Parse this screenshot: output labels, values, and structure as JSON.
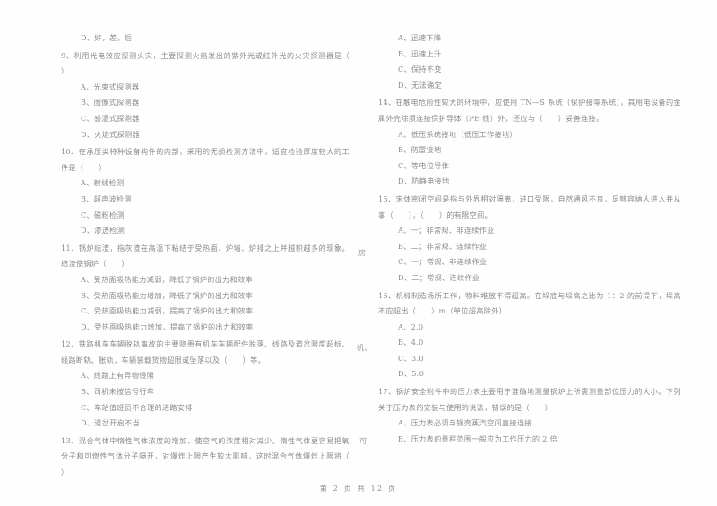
{
  "document": {
    "page_footer": "第 2 页  共 12 页",
    "page_number": "2",
    "total_pages": "12",
    "text_color": "#8a8a8a",
    "background_color": "#fefefe"
  },
  "left_column": {
    "orphan_option": "D、好，差，后",
    "questions": [
      {
        "stem": "9、利用光电效应探测火灾，主要探测火焰发出的紫外光或红外光的火灾探测器是（　　）",
        "options": [
          "A、光束式探测器",
          "B、图像式探测器",
          "C、感温式探测器",
          "D、火焰式探测器"
        ]
      },
      {
        "stem": "10、在承压类特种设备构件的内部，采用的无损检测方法中，适宜检验厚度较大的工件是（　　）",
        "options": [
          "A、射线检测",
          "B、超声波检测",
          "C、磁粉检测",
          "D、渗透检测"
        ]
      },
      {
        "stem": "11、锅炉结渣，指灰渣在高温下粘结于受热面、炉墙、炉排之上并越积越多的现象。结渣使锅炉（　　）",
        "options": [
          "A、受热面吸热能力减弱，降低了锅炉的出力和效率",
          "B、受热面吸热能力增加，降低了锅炉的出力和效率",
          "C、受热面吸热能力减弱，提高了锅炉的出力和效率",
          "D、受热面吸热能力增加，提高了锅炉的出力和效率"
        ]
      },
      {
        "stem": "12、铁路机车车辆脱轨事故的主要隐患有机车车辆配件脱落、线路及道岔限度超标、线路断轨、胀轨，车辆装载货物超限或坠落以及（　　）等。",
        "options": [
          "A、线路上有异物侵限",
          "B、司机未按信号行车",
          "C、车站值班员不合理的进路安排",
          "D、道岔开启不当"
        ]
      },
      {
        "stem": "13、混合气体中惰性气体浓度的增加，使空气的浓度相对减少。惰性气体更容易把氧分子和可燃性气体分子隔开，对爆炸上限产生较大影响，这时混合气体爆炸上限将（　　）",
        "options": []
      }
    ]
  },
  "right_column": {
    "orphan_options": [
      "A、迅速下降",
      "B、迅速上升",
      "C、保持不变",
      "D、无法确定"
    ],
    "questions": [
      {
        "stem": "14、在触电危险性较大的环境中，应使用 TN—S 系统（保护接零系统），其用电设备的金属外壳除须连接保护导体（PE 线）外，还应与（　　）妥善连接。",
        "options": [
          "A、低压系统接地（低压工作接地）",
          "B、防雷接地",
          "C、等电位导体",
          "D、防静电接地"
        ]
      },
      {
        "stem": "15、宋体密闭空间是指与外界相对隔离，进口受限，自然通风不良，足够容纳人进入并从事（　　），（　　）的有限空间。",
        "options": [
          "A、一；非常规、非连续作业",
          "B、二；非常规、连续作业",
          "C、一；常规、非连续作业",
          "D、二；常规、连续作业"
        ]
      },
      {
        "stem": "16、机械制造场所工作，物料堆放不得超高。在垛底与垛高之比为 1：2 的前提下，垛高不应超出（　　）m（单位超高除外）",
        "options": [
          "A、2.0",
          "B、4.0",
          "C、3.0",
          "D、5.0"
        ]
      },
      {
        "stem": "17、锅炉安全附件中的压力表主要用于准确地测量锅炉上所需测量部位压力的大小。下列关于压力表的安装与使用的说法，错误的是（　　）",
        "options": [
          "A、压力表必须与锅壳蒸汽空间直接连接",
          "B、压力表的量程范围一般应为工作压力的 2 倍"
        ]
      }
    ],
    "margin_fragments": [
      "房",
      "机、",
      "可"
    ]
  }
}
